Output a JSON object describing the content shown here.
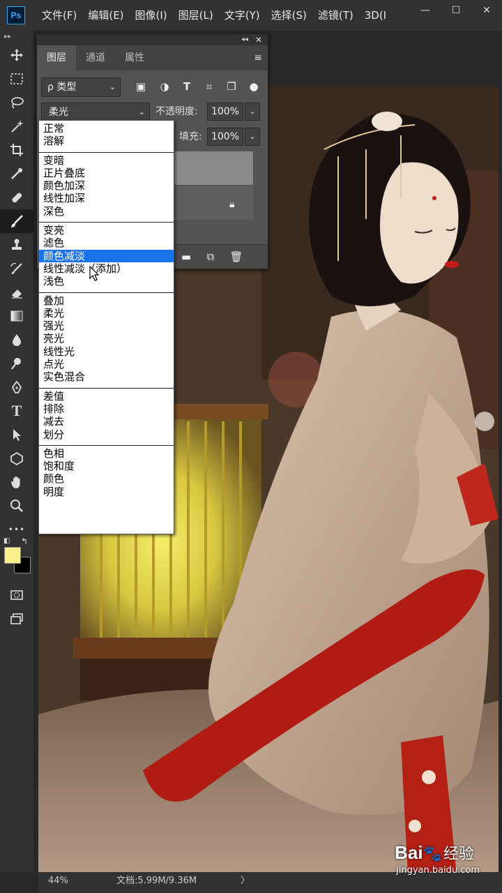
{
  "app": {
    "logo": "Ps"
  },
  "menubar": {
    "items": [
      "文件(F)",
      "编辑(E)",
      "图像(I)",
      "图层(L)",
      "文字(Y)",
      "选择(S)",
      "滤镜(T)",
      "3D(I"
    ],
    "window_controls": {
      "minimize": "—",
      "maximize": "☐",
      "close": "✕"
    }
  },
  "toolbar": {
    "tools": [
      "move-icon",
      "marquee-icon",
      "lasso-icon",
      "magic-wand-icon",
      "crop-icon",
      "eyedropper-icon",
      "healing-icon",
      "brush-icon",
      "stamp-icon",
      "history-brush-icon",
      "eraser-icon",
      "gradient-icon",
      "blur-icon",
      "dodge-icon",
      "pen-icon",
      "type-icon",
      "path-select-icon",
      "shape-icon",
      "hand-icon",
      "zoom-icon",
      "more-icon"
    ],
    "type_glyph": "T",
    "more_glyph": "•••",
    "foreground_color": "#faf08c",
    "background_color": "#000000"
  },
  "layers_panel": {
    "tabs": [
      "图层",
      "通道",
      "属性"
    ],
    "filter_kind": "ρ 类型",
    "blend_mode": "柔光",
    "opacity_label": "不透明度:",
    "opacity_value": "100%",
    "fill_label": "填充:",
    "fill_value": "100%"
  },
  "blend_modes": {
    "groups": [
      [
        "正常",
        "溶解"
      ],
      [
        "变暗",
        "正片叠底",
        "颜色加深",
        "线性加深",
        "深色"
      ],
      [
        "变亮",
        "滤色",
        "颜色减淡",
        "线性减淡（添加）",
        "浅色"
      ],
      [
        "叠加",
        "柔光",
        "强光",
        "亮光",
        "线性光",
        "点光",
        "实色混合"
      ],
      [
        "差值",
        "排除",
        "减去",
        "划分"
      ],
      [
        "色相",
        "饱和度",
        "颜色",
        "明度"
      ]
    ],
    "highlighted": "颜色减淡"
  },
  "statusbar": {
    "zoom": "44%",
    "doc_info": "文档:5.99M/9.36M",
    "arrow": "〉"
  },
  "watermark": {
    "logo": "Bai",
    "paw": "🐾",
    "text": "经验",
    "url": "jingyan.baidu.com"
  }
}
